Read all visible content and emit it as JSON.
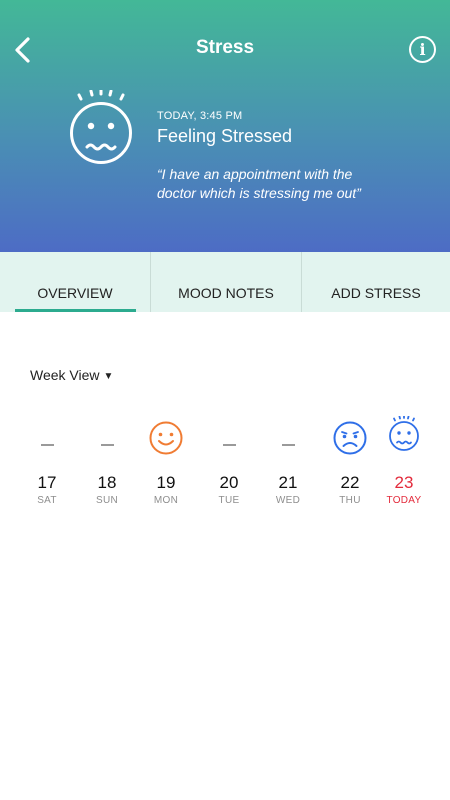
{
  "header": {
    "title": "Stress",
    "time": "TODAY, 3:45 PM",
    "status": "Feeling Stressed",
    "quote": "“I have an appointment with the doctor which is stressing me out”",
    "info_glyph": "i"
  },
  "tabs": [
    {
      "label": "OVERVIEW",
      "active": true
    },
    {
      "label": "MOOD NOTES",
      "active": false
    },
    {
      "label": "ADD STRESS",
      "active": false
    }
  ],
  "week_view": {
    "label": "Week View"
  },
  "days": [
    {
      "num": "17",
      "dow": "SAT",
      "mood": "none"
    },
    {
      "num": "18",
      "dow": "SUN",
      "mood": "none"
    },
    {
      "num": "19",
      "dow": "MON",
      "mood": "happy"
    },
    {
      "num": "20",
      "dow": "TUE",
      "mood": "none"
    },
    {
      "num": "21",
      "dow": "WED",
      "mood": "none"
    },
    {
      "num": "22",
      "dow": "THU",
      "mood": "sad"
    },
    {
      "num": "23",
      "dow": "TODAY",
      "mood": "stressed"
    }
  ],
  "colors": {
    "happy": "#f07c33",
    "sad": "#2f6fe8",
    "stressed": "#2f6fe8",
    "today": "#e32b3c",
    "accent": "#2cab8f"
  }
}
